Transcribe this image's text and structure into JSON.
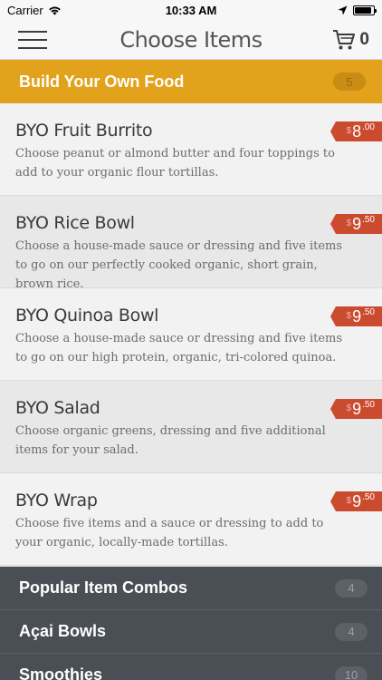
{
  "status_bar": {
    "carrier": "Carrier",
    "time": "10:33 AM",
    "battery_level": 0.9
  },
  "nav": {
    "title": "Choose Items",
    "cart_count": "0"
  },
  "active_section": {
    "title": "Build Your Own Food",
    "count": "5"
  },
  "items": [
    {
      "name": "BYO Fruit Burrito",
      "description": "Choose peanut or almond butter and four toppings to add to your organic flour tortillas.",
      "price_currency": "$",
      "price_whole": "8",
      "price_cents": ".00"
    },
    {
      "name": "BYO Rice Bowl",
      "description": "Choose a house-made sauce or dressing and five items to go on our perfectly cooked organic, short grain, brown rice.",
      "price_currency": "$",
      "price_whole": "9",
      "price_cents": ".50"
    },
    {
      "name": "BYO Quinoa Bowl",
      "description": "Choose a house-made sauce or dressing and five items to go on our high protein, organic, tri-colored quinoa.",
      "price_currency": "$",
      "price_whole": "9",
      "price_cents": ".50"
    },
    {
      "name": "BYO Salad",
      "description": "Choose organic greens, dressing and five additional items for your salad.",
      "price_currency": "$",
      "price_whole": "9",
      "price_cents": ".50"
    },
    {
      "name": "BYO Wrap",
      "description": "Choose five items and a sauce or dressing to add to your organic, locally-made tortillas.",
      "price_currency": "$",
      "price_whole": "9",
      "price_cents": ".50"
    }
  ],
  "sections": [
    {
      "title": "Popular Item Combos",
      "count": "4"
    },
    {
      "title": "Açai Bowls",
      "count": "4"
    },
    {
      "title": "Smoothies",
      "count": "10"
    }
  ],
  "colors": {
    "accent_orange": "#e3a21b",
    "price_red": "#cb4b2f",
    "dark_section": "#4a4f55"
  }
}
